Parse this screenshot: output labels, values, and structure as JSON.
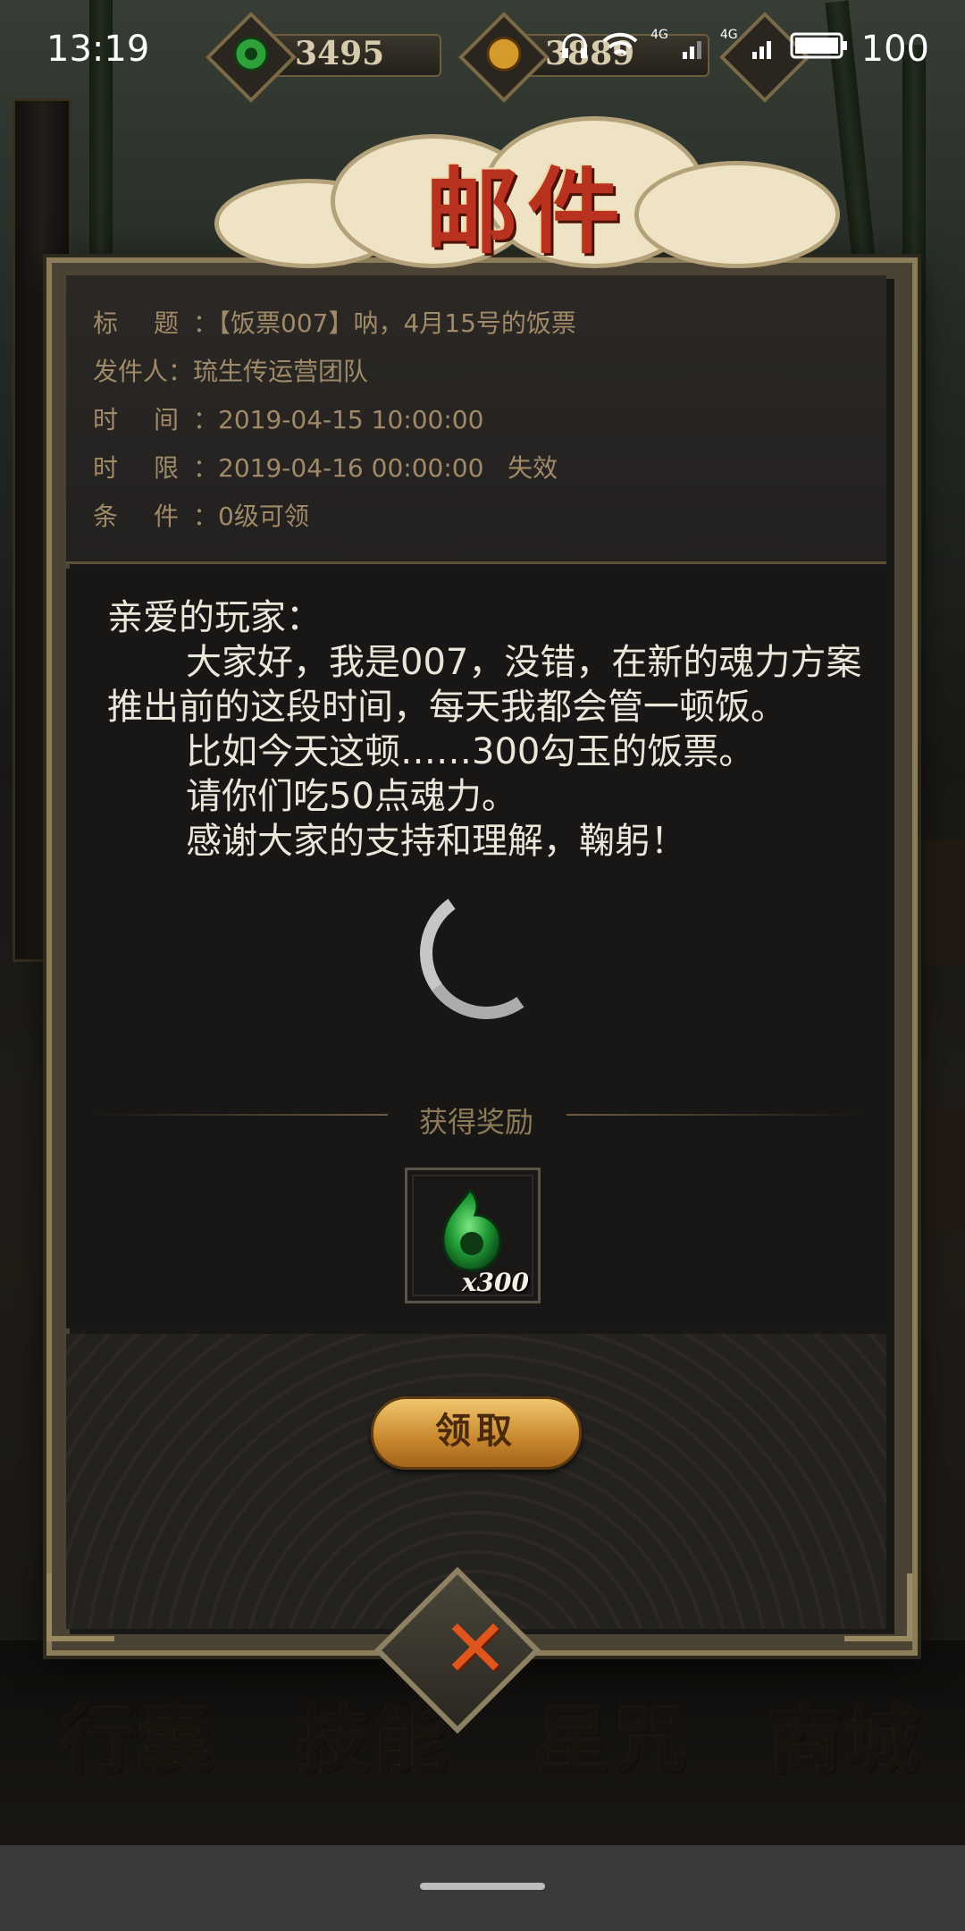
{
  "status_bar": {
    "time": "13:19",
    "resource_1_value": "3495",
    "resource_2_value": "3889",
    "network_1": "4G",
    "network_2": "4G",
    "battery": "100"
  },
  "modal": {
    "title": "邮件",
    "info": {
      "subject_label": "标题",
      "subject_value": "【饭票007】呐，4月15号的饭票",
      "sender_label": "发件人",
      "sender_value": "琉生传运营团队",
      "time_label": "时间",
      "time_value": "2019-04-15 10:00:00",
      "deadline_label": "时限",
      "deadline_value": "2019-04-16 00:00:00",
      "deadline_status": "失效",
      "condition_label": "条件",
      "condition_value": "0级可领"
    },
    "message": {
      "greeting": "亲爱的玩家：",
      "paragraph_1": "大家好，我是007，没错，在新的魂力方案推出前的这段时间，每天我都会管一顿饭。",
      "paragraph_2": "比如今天这顿……300勾玉的饭票。",
      "paragraph_3": "请你们吃50点魂力。",
      "paragraph_4": "感谢大家的支持和理解，鞠躬！"
    },
    "reward": {
      "title": "获得奖励",
      "item_icon": "green-magatama-icon",
      "item_count": "x300"
    },
    "claim_button": "领取",
    "close_icon": "close-x-icon"
  },
  "bottom_nav": [
    "行囊",
    "技能",
    "星咒",
    "商城"
  ],
  "colors": {
    "accent_gold": "#c7862c",
    "close_red": "#e0551c",
    "title_red": "#b8321f",
    "label_tan": "#a08a68",
    "message_text": "#ece6da"
  }
}
